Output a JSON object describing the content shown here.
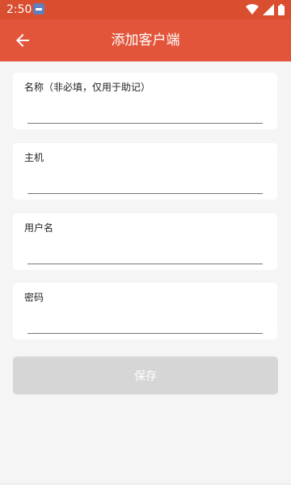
{
  "status_bar": {
    "time": "2:50",
    "icons": [
      "notification-icon",
      "wifi-icon",
      "signal-icon",
      "battery-icon"
    ],
    "color": "#d94e2f"
  },
  "app_bar": {
    "title": "添加客户端",
    "back_icon": "arrow-back-icon",
    "color": "#e2553a"
  },
  "form": {
    "fields": [
      {
        "label": "名称（非必填，仅用于助记）",
        "value": ""
      },
      {
        "label": "主机",
        "value": ""
      },
      {
        "label": "用户名",
        "value": ""
      },
      {
        "label": "密码",
        "value": ""
      }
    ]
  },
  "actions": {
    "save_label": "保存",
    "save_color": "#d6d6d6"
  }
}
